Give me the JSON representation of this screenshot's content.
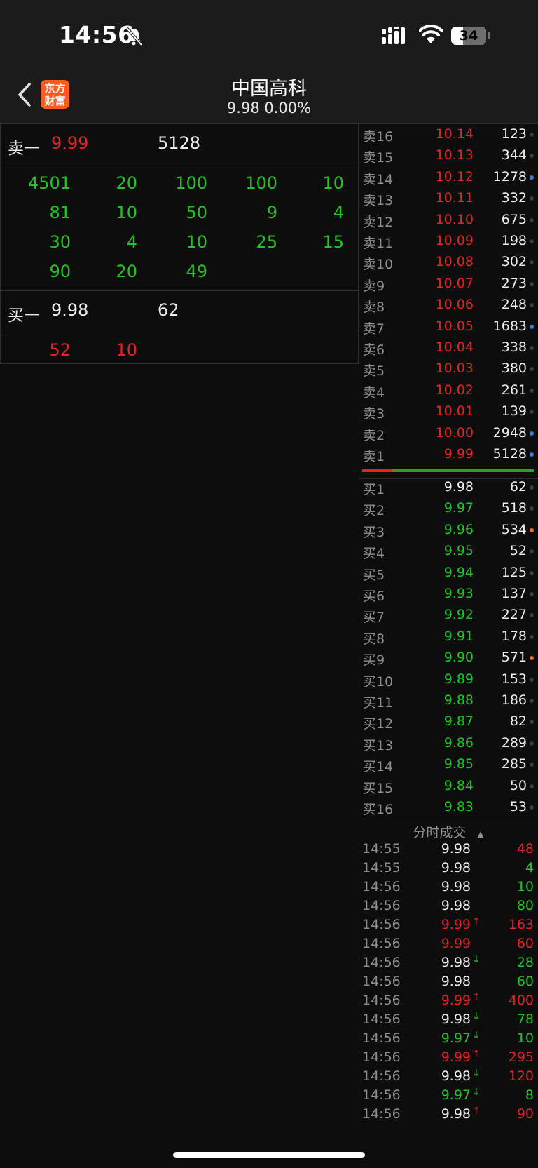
{
  "status": {
    "time": "14:56",
    "battery": "34",
    "battery_level": 0.34
  },
  "header": {
    "logo_line1": "东方",
    "logo_line2": "财富",
    "name": "中国高科",
    "price_line": "9.98  0.00%"
  },
  "left": {
    "sell_label": "卖一",
    "sell_price": "9.99",
    "sell_volume": "5128",
    "sell_queue": [
      [
        "4501",
        "20",
        "100",
        "100",
        "10"
      ],
      [
        "81",
        "10",
        "50",
        "9",
        "4"
      ],
      [
        "30",
        "4",
        "10",
        "25",
        "15"
      ],
      [
        "90",
        "20",
        "49",
        "",
        ""
      ]
    ],
    "buy_label": "买一",
    "buy_price": "9.98",
    "buy_volume": "62",
    "buy_queue": [
      [
        "52",
        "10",
        "",
        "",
        ""
      ]
    ]
  },
  "asks": [
    {
      "label": "卖16",
      "price": "10.14",
      "volume": "123",
      "dot": "gray"
    },
    {
      "label": "卖15",
      "price": "10.13",
      "volume": "344",
      "dot": "gray"
    },
    {
      "label": "卖14",
      "price": "10.12",
      "volume": "1278",
      "dot": "blue"
    },
    {
      "label": "卖13",
      "price": "10.11",
      "volume": "332",
      "dot": "gray"
    },
    {
      "label": "卖12",
      "price": "10.10",
      "volume": "675",
      "dot": "gray"
    },
    {
      "label": "卖11",
      "price": "10.09",
      "volume": "198",
      "dot": "gray"
    },
    {
      "label": "卖10",
      "price": "10.08",
      "volume": "302",
      "dot": "gray"
    },
    {
      "label": "卖9",
      "price": "10.07",
      "volume": "273",
      "dot": "gray"
    },
    {
      "label": "卖8",
      "price": "10.06",
      "volume": "248",
      "dot": "gray"
    },
    {
      "label": "卖7",
      "price": "10.05",
      "volume": "1683",
      "dot": "blue"
    },
    {
      "label": "卖6",
      "price": "10.04",
      "volume": "338",
      "dot": "gray"
    },
    {
      "label": "卖5",
      "price": "10.03",
      "volume": "380",
      "dot": "gray"
    },
    {
      "label": "卖4",
      "price": "10.02",
      "volume": "261",
      "dot": "gray"
    },
    {
      "label": "卖3",
      "price": "10.01",
      "volume": "139",
      "dot": "gray"
    },
    {
      "label": "卖2",
      "price": "10.00",
      "volume": "2948",
      "dot": "blue"
    },
    {
      "label": "卖1",
      "price": "9.99",
      "volume": "5128",
      "dot": "blue"
    }
  ],
  "bids": [
    {
      "label": "买1",
      "price": "9.98",
      "volume": "62",
      "dot": "gray",
      "pcolor": "white"
    },
    {
      "label": "买2",
      "price": "9.97",
      "volume": "518",
      "dot": "gray",
      "pcolor": "green"
    },
    {
      "label": "买3",
      "price": "9.96",
      "volume": "534",
      "dot": "orange",
      "pcolor": "green"
    },
    {
      "label": "买4",
      "price": "9.95",
      "volume": "52",
      "dot": "gray",
      "pcolor": "green"
    },
    {
      "label": "买5",
      "price": "9.94",
      "volume": "125",
      "dot": "gray",
      "pcolor": "green"
    },
    {
      "label": "买6",
      "price": "9.93",
      "volume": "137",
      "dot": "gray",
      "pcolor": "green"
    },
    {
      "label": "买7",
      "price": "9.92",
      "volume": "227",
      "dot": "gray",
      "pcolor": "green"
    },
    {
      "label": "买8",
      "price": "9.91",
      "volume": "178",
      "dot": "gray",
      "pcolor": "green"
    },
    {
      "label": "买9",
      "price": "9.90",
      "volume": "571",
      "dot": "orange",
      "pcolor": "green"
    },
    {
      "label": "买10",
      "price": "9.89",
      "volume": "153",
      "dot": "gray",
      "pcolor": "green"
    },
    {
      "label": "买11",
      "price": "9.88",
      "volume": "186",
      "dot": "gray",
      "pcolor": "green"
    },
    {
      "label": "买12",
      "price": "9.87",
      "volume": "82",
      "dot": "gray",
      "pcolor": "green"
    },
    {
      "label": "买13",
      "price": "9.86",
      "volume": "289",
      "dot": "gray",
      "pcolor": "green"
    },
    {
      "label": "买14",
      "price": "9.85",
      "volume": "285",
      "dot": "gray",
      "pcolor": "green"
    },
    {
      "label": "买15",
      "price": "9.84",
      "volume": "50",
      "dot": "gray",
      "pcolor": "green"
    },
    {
      "label": "买16",
      "price": "9.83",
      "volume": "53",
      "dot": "gray",
      "pcolor": "green"
    }
  ],
  "ratio": {
    "sell_fraction": 0.17
  },
  "trades": {
    "title": "分时成交",
    "items": [
      {
        "time": "14:55",
        "price": "9.98",
        "arrow": "",
        "volume": "48",
        "pcolor": "white",
        "vcolor": "red"
      },
      {
        "time": "14:55",
        "price": "9.98",
        "arrow": "",
        "volume": "4",
        "pcolor": "white",
        "vcolor": "green"
      },
      {
        "time": "14:56",
        "price": "9.98",
        "arrow": "",
        "volume": "10",
        "pcolor": "white",
        "vcolor": "green"
      },
      {
        "time": "14:56",
        "price": "9.98",
        "arrow": "",
        "volume": "80",
        "pcolor": "white",
        "vcolor": "green"
      },
      {
        "time": "14:56",
        "price": "9.99",
        "arrow": "↑",
        "volume": "163",
        "pcolor": "red",
        "vcolor": "red"
      },
      {
        "time": "14:56",
        "price": "9.99",
        "arrow": "",
        "volume": "60",
        "pcolor": "red",
        "vcolor": "red"
      },
      {
        "time": "14:56",
        "price": "9.98",
        "arrow": "↓",
        "volume": "28",
        "pcolor": "white",
        "vcolor": "green"
      },
      {
        "time": "14:56",
        "price": "9.98",
        "arrow": "",
        "volume": "60",
        "pcolor": "white",
        "vcolor": "green"
      },
      {
        "time": "14:56",
        "price": "9.99",
        "arrow": "↑",
        "volume": "400",
        "pcolor": "red",
        "vcolor": "red"
      },
      {
        "time": "14:56",
        "price": "9.98",
        "arrow": "↓",
        "volume": "78",
        "pcolor": "white",
        "vcolor": "green"
      },
      {
        "time": "14:56",
        "price": "9.97",
        "arrow": "↓",
        "volume": "10",
        "pcolor": "green",
        "vcolor": "green"
      },
      {
        "time": "14:56",
        "price": "9.99",
        "arrow": "↑",
        "volume": "295",
        "pcolor": "red",
        "vcolor": "red"
      },
      {
        "time": "14:56",
        "price": "9.98",
        "arrow": "↓",
        "volume": "120",
        "pcolor": "white",
        "vcolor": "red"
      },
      {
        "time": "14:56",
        "price": "9.97",
        "arrow": "↓",
        "volume": "8",
        "pcolor": "green",
        "vcolor": "green"
      },
      {
        "time": "14:56",
        "price": "9.98",
        "arrow": "↑",
        "volume": "90",
        "pcolor": "white",
        "vcolor": "red"
      }
    ]
  },
  "colors": {
    "red": "#e02424",
    "green": "#22c422",
    "blue": "#3d7bd9",
    "orange": "#ff6a1f",
    "gray": "#3a3a3a"
  }
}
